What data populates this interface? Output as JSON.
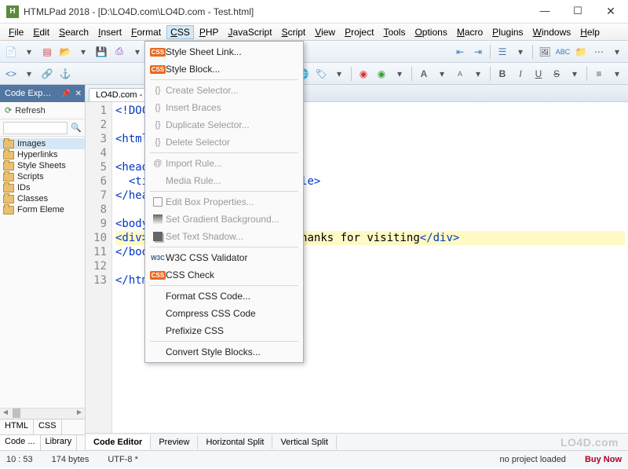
{
  "title": "HTMLPad 2018 - [D:\\LO4D.com\\LO4D.com - Test.html]",
  "winbtns": {
    "min": "—",
    "max": "☐",
    "close": "✕"
  },
  "menu": [
    "File",
    "Edit",
    "Search",
    "Insert",
    "Format",
    "CSS",
    "PHP",
    "JavaScript",
    "Script",
    "View",
    "Project",
    "Tools",
    "Options",
    "Macro",
    "Plugins",
    "Windows",
    "Help"
  ],
  "active_menu": "CSS",
  "dropdown": [
    {
      "label": "Style Sheet Link...",
      "enabled": true,
      "icon": "css"
    },
    {
      "label": "Style Block...",
      "enabled": true,
      "icon": "css"
    },
    {
      "sep": true
    },
    {
      "label": "Create Selector...",
      "enabled": false,
      "icon": "braces"
    },
    {
      "label": "Insert Braces",
      "enabled": false,
      "icon": "braces"
    },
    {
      "label": "Duplicate Selector...",
      "enabled": false,
      "icon": "braces"
    },
    {
      "label": "Delete Selector",
      "enabled": false,
      "icon": "braces"
    },
    {
      "sep": true
    },
    {
      "label": "Import Rule...",
      "enabled": false,
      "icon": "at"
    },
    {
      "label": "Media Rule...",
      "enabled": false,
      "icon": ""
    },
    {
      "sep": true
    },
    {
      "label": "Edit Box Properties...",
      "enabled": false,
      "icon": "box"
    },
    {
      "label": "Set Gradient Background...",
      "enabled": false,
      "icon": "grad"
    },
    {
      "label": "Set Text Shadow...",
      "enabled": false,
      "icon": "shadow"
    },
    {
      "sep": true
    },
    {
      "label": "W3C CSS Validator",
      "enabled": true,
      "icon": "w3c"
    },
    {
      "label": "CSS Check",
      "enabled": true,
      "icon": "css"
    },
    {
      "sep": true
    },
    {
      "label": "Format CSS Code...",
      "enabled": true,
      "icon": ""
    },
    {
      "label": "Compress CSS Code",
      "enabled": true,
      "icon": ""
    },
    {
      "label": "Prefixize CSS",
      "enabled": true,
      "icon": ""
    },
    {
      "sep": true
    },
    {
      "label": "Convert Style Blocks...",
      "enabled": true,
      "icon": ""
    }
  ],
  "sidepanel": {
    "title": "Code Exp…",
    "refresh": "Refresh",
    "items": [
      "Images",
      "Hyperlinks",
      "Style Sheets",
      "Scripts",
      "IDs",
      "Classes",
      "Form Eleme"
    ],
    "tabsA": [
      "HTML",
      "CSS"
    ],
    "tabsB": [
      "Code ...",
      "Library"
    ]
  },
  "filetab": "LO4D.com - Te",
  "code_lines": [
    {
      "n": 1,
      "html": "<span class='tag'>&lt;!DOCT</span>"
    },
    {
      "n": 2,
      "html": ""
    },
    {
      "n": 3,
      "html": "<span class='tag'>&lt;html&gt;</span>"
    },
    {
      "n": 4,
      "html": ""
    },
    {
      "n": 5,
      "html": "<span class='tag'>&lt;head&gt;</span>"
    },
    {
      "n": 6,
      "html": "  <span class='tag'>&lt;titl</span>                <span class='tag'>&lt;/title&gt;</span>"
    },
    {
      "n": 7,
      "html": "<span class='tag'>&lt;/head</span>"
    },
    {
      "n": 8,
      "html": ""
    },
    {
      "n": 9,
      "html": "<span class='tag'>&lt;body&gt;</span>"
    },
    {
      "n": 10,
      "html": "<span class='tag'>&lt;div&gt;</span><span class='txt'>T</span>                 <span class='tag'>r /&gt;</span><span class='txt'>Thanks for visiting</span><span class='tag'>&lt;/div&gt;</span>",
      "hl": true
    },
    {
      "n": 11,
      "html": "<span class='tag'>&lt;/body</span>"
    },
    {
      "n": 12,
      "html": ""
    },
    {
      "n": 13,
      "html": "<span class='tag'>&lt;/html</span>"
    }
  ],
  "viewtabs": [
    "Code Editor",
    "Preview",
    "Horizontal Split",
    "Vertical Split"
  ],
  "status": {
    "pos": "10 : 53",
    "size": "174 bytes",
    "enc": "UTF-8 *",
    "proj": "no project loaded",
    "buy": "Buy Now"
  },
  "watermark": "LO4D.com"
}
